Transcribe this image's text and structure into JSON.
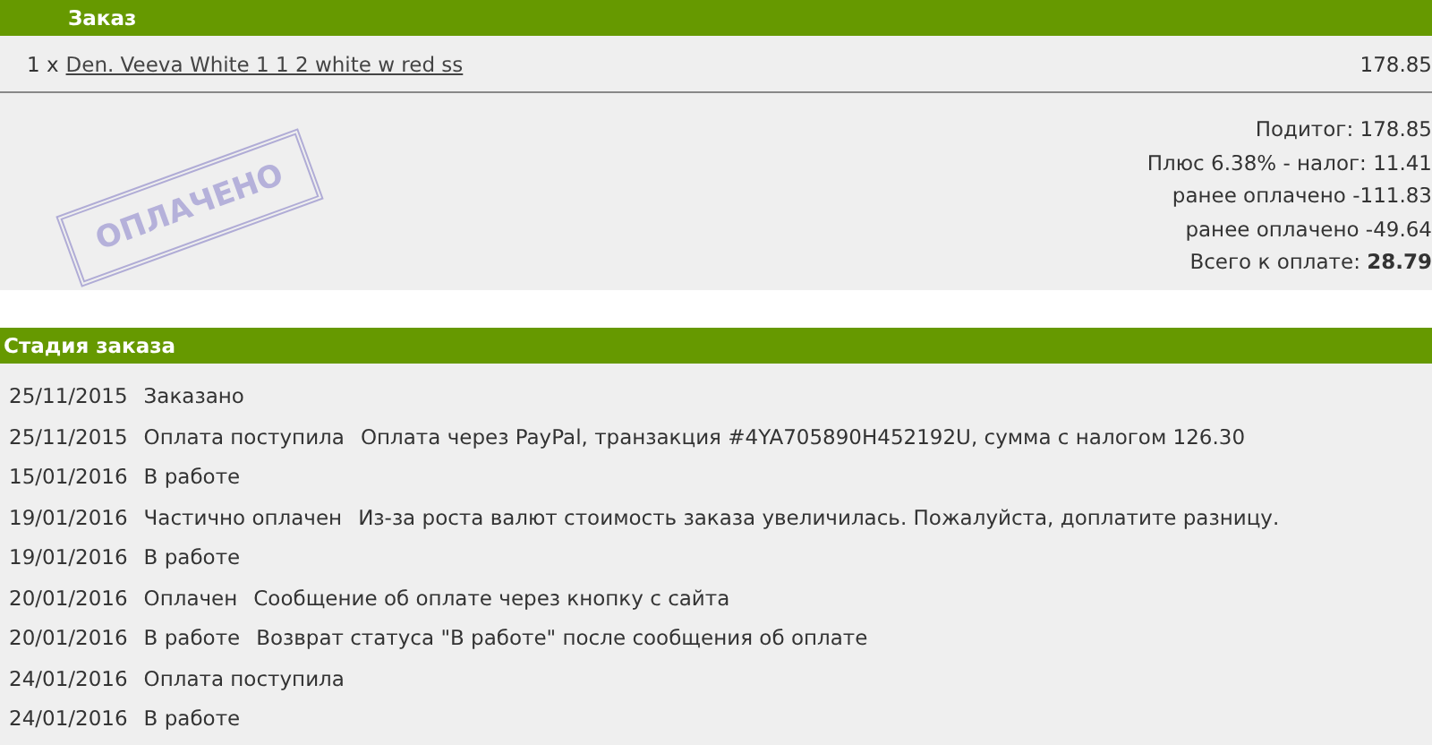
{
  "order": {
    "title": "Заказ",
    "items": [
      {
        "quantity": "1 x",
        "name": "Den. Veeva White 1 1 2 white w red ss",
        "price": "178.85"
      }
    ],
    "stamp": "ОПЛАЧЕНО",
    "totals": [
      {
        "label": "Подитог:",
        "value": "178.85",
        "bold": false
      },
      {
        "label": "Плюс 6.38% - налог:",
        "value": "11.41",
        "bold": false
      },
      {
        "label": "ранее оплачено",
        "value": "-111.83",
        "bold": false
      },
      {
        "label": "ранее оплачено",
        "value": "-49.64",
        "bold": false
      },
      {
        "label": "Всего к оплате:",
        "value": "28.79",
        "bold": true
      }
    ]
  },
  "history": {
    "title": "Стадия заказа",
    "rows": [
      {
        "date": "25/11/2015",
        "status": "Заказано"
      },
      {
        "date": "25/11/2015",
        "status": "Оплата поступила",
        "comment": "Оплата через PayPal, транзакция #4YA705890H452192U, сумма с налогом 126.30"
      },
      {
        "date": "15/01/2016",
        "status": "В работе"
      },
      {
        "date": "19/01/2016",
        "status": "Частично оплачен",
        "comment": "Из-за роста валют стоимость заказа увеличилась. Пожалуйста, доплатите разницу."
      },
      {
        "date": "19/01/2016",
        "status": "В работе"
      },
      {
        "date": "20/01/2016",
        "status": "Оплачен",
        "comment": "Сообщение об оплате через кнопку с сайта"
      },
      {
        "date": "20/01/2016",
        "status": "В работе",
        "comment": "Возврат статуса \"В работе\" после сообщения об оплате"
      },
      {
        "date": "24/01/2016",
        "status": "Оплата поступила"
      },
      {
        "date": "24/01/2016",
        "status": "В работе"
      }
    ]
  }
}
